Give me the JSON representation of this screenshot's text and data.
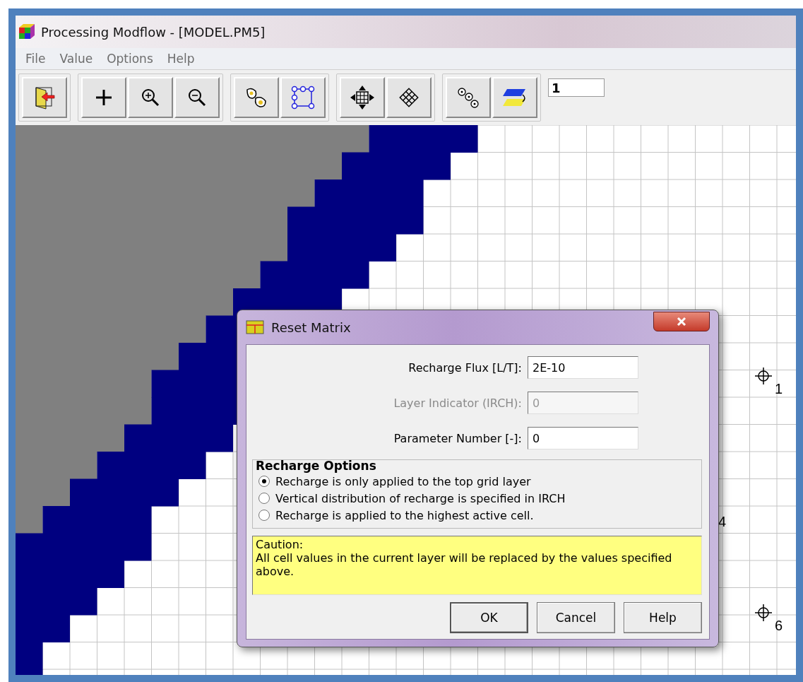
{
  "window": {
    "title": "Processing Modflow - [MODEL.PM5]"
  },
  "menu": [
    "File",
    "Value",
    "Options",
    "Help"
  ],
  "toolbar": {
    "groups": [
      [
        {
          "kind": "exit"
        }
      ],
      [
        {
          "kind": "cross"
        },
        {
          "kind": "zoom-in"
        },
        {
          "kind": "zoom-out"
        }
      ],
      [
        {
          "kind": "cells"
        },
        {
          "kind": "polygon"
        }
      ],
      [
        {
          "kind": "move"
        },
        {
          "kind": "grid"
        }
      ],
      [
        {
          "kind": "gears"
        },
        {
          "kind": "layers"
        }
      ]
    ],
    "layer_field": "1"
  },
  "markers": [
    {
      "kind": "well",
      "label": "1"
    },
    {
      "kind": "text",
      "label": "4"
    },
    {
      "kind": "well",
      "label": "6"
    }
  ],
  "dialog": {
    "title": "Reset Matrix",
    "fields": [
      {
        "label": "Recharge Flux [L/T]:",
        "value": "2E-10",
        "disabled": false
      },
      {
        "label": "Layer Indicator (IRCH):",
        "value": "0",
        "disabled": true
      },
      {
        "label": "Parameter Number [-]:",
        "value": "0",
        "disabled": false
      }
    ],
    "options_title": "Recharge Options",
    "options": [
      {
        "label": "Recharge is only applied to the top grid layer",
        "selected": true
      },
      {
        "label": "Vertical distribution of recharge is specified in IRCH",
        "selected": false
      },
      {
        "label": "Recharge is applied to the highest active cell.",
        "selected": false
      }
    ],
    "caution": [
      "Caution:",
      "All cell values in the current layer will be replaced by the values specified above."
    ],
    "buttons": [
      "OK",
      "Cancel",
      "Help"
    ]
  }
}
